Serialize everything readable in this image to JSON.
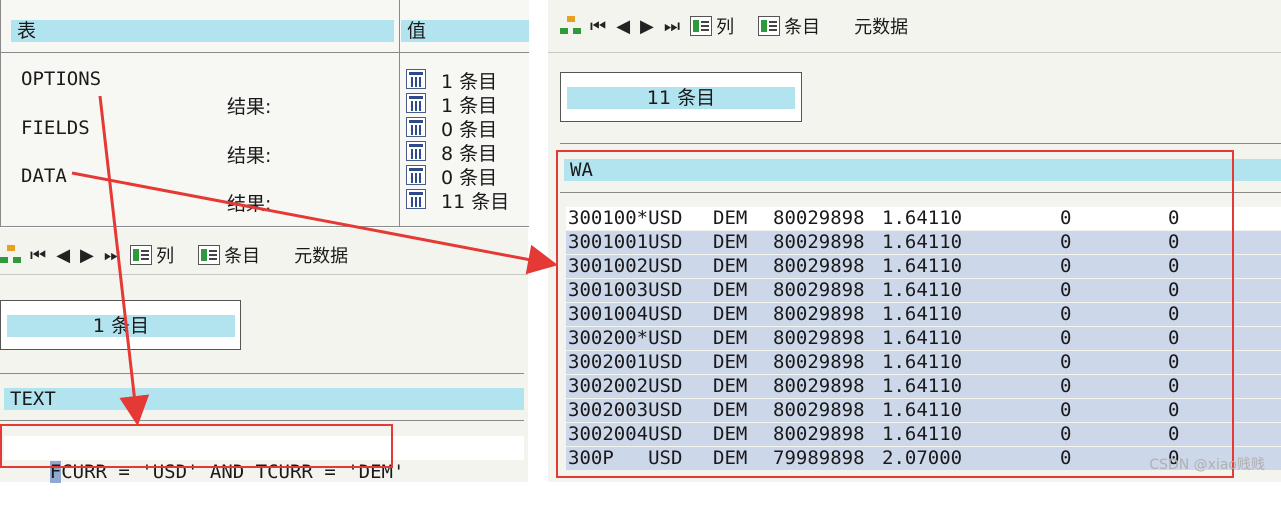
{
  "left_table": {
    "col_table": "表",
    "col_value": "值",
    "params": [
      "OPTIONS",
      "FIELDS",
      "DATA"
    ],
    "result_label": "结果:",
    "values": [
      "1 条目",
      "1 条目",
      "0 条目",
      "8 条目",
      "0 条目",
      "11 条目"
    ]
  },
  "toolbar": {
    "columns_label": "列",
    "entries_label": "条目",
    "metadata_label": "元数据"
  },
  "options_view": {
    "count": "1 条目",
    "column_header": "TEXT",
    "cursor_char": "F",
    "row_text": "CURR = 'USD' AND TCURR = 'DEM'"
  },
  "data_view": {
    "count": "11 条目",
    "column_header": "WA",
    "rows": [
      {
        "key": "300100*USD",
        "cur": "DEM",
        "date": "80029898",
        "rate": "1.64110",
        "f1": "0",
        "f2": "0"
      },
      {
        "key": "3001001USD",
        "cur": "DEM",
        "date": "80029898",
        "rate": "1.64110",
        "f1": "0",
        "f2": "0"
      },
      {
        "key": "3001002USD",
        "cur": "DEM",
        "date": "80029898",
        "rate": "1.64110",
        "f1": "0",
        "f2": "0"
      },
      {
        "key": "3001003USD",
        "cur": "DEM",
        "date": "80029898",
        "rate": "1.64110",
        "f1": "0",
        "f2": "0"
      },
      {
        "key": "3001004USD",
        "cur": "DEM",
        "date": "80029898",
        "rate": "1.64110",
        "f1": "0",
        "f2": "0"
      },
      {
        "key": "300200*USD",
        "cur": "DEM",
        "date": "80029898",
        "rate": "1.64110",
        "f1": "0",
        "f2": "0"
      },
      {
        "key": "3002001USD",
        "cur": "DEM",
        "date": "80029898",
        "rate": "1.64110",
        "f1": "0",
        "f2": "0"
      },
      {
        "key": "3002002USD",
        "cur": "DEM",
        "date": "80029898",
        "rate": "1.64110",
        "f1": "0",
        "f2": "0"
      },
      {
        "key": "3002003USD",
        "cur": "DEM",
        "date": "80029898",
        "rate": "1.64110",
        "f1": "0",
        "f2": "0"
      },
      {
        "key": "3002004USD",
        "cur": "DEM",
        "date": "80029898",
        "rate": "1.64110",
        "f1": "0",
        "f2": "0"
      },
      {
        "key": "300P   USD",
        "cur": "DEM",
        "date": "79989898",
        "rate": "2.07000",
        "f1": "0",
        "f2": "0"
      }
    ]
  },
  "watermark": "CSDN @xiao贱贱",
  "colors": {
    "header_bg": "#b2e4f0",
    "row_bg": "#cdd7ea",
    "highlight": "#e53935"
  }
}
